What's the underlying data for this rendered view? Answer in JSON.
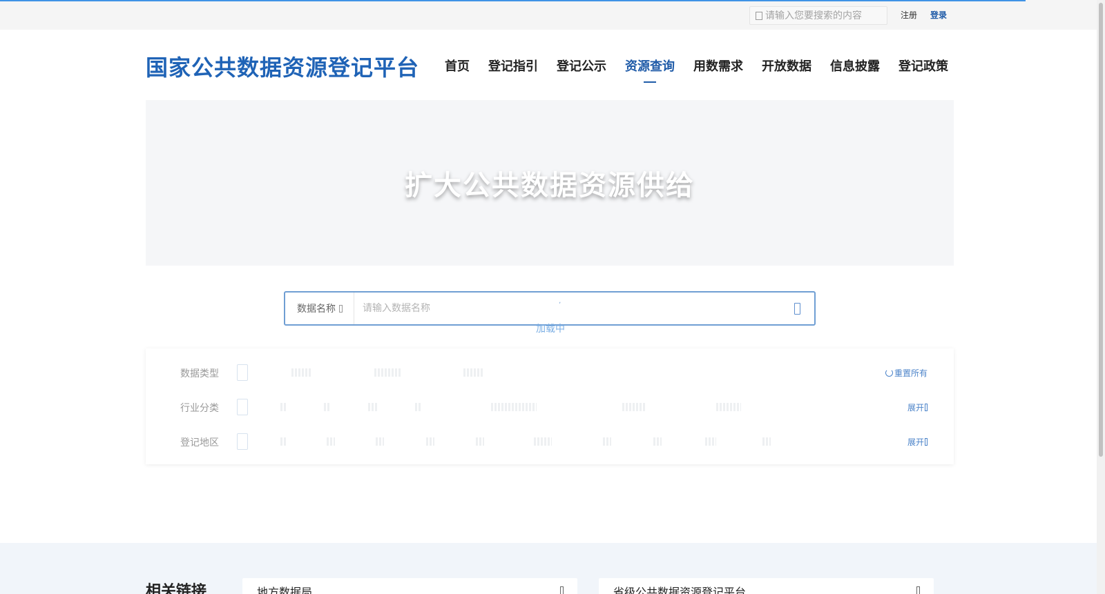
{
  "topbar": {
    "search_placeholder": "请输入您要搜索的内容",
    "register": "注册",
    "login": "登录"
  },
  "header": {
    "logo": "国家公共数据资源登记平台",
    "nav": [
      {
        "label": "首页",
        "active": false
      },
      {
        "label": "登记指引",
        "active": false
      },
      {
        "label": "登记公示",
        "active": false
      },
      {
        "label": "资源查询",
        "active": true
      },
      {
        "label": "用数需求",
        "active": false
      },
      {
        "label": "开放数据",
        "active": false
      },
      {
        "label": "信息披露",
        "active": false
      },
      {
        "label": "登记政策",
        "active": false
      }
    ]
  },
  "banner": {
    "title": "扩大公共数据资源供给"
  },
  "search": {
    "type_label": "数据名称",
    "placeholder": "请输入数据名称",
    "loading_text": "加载中"
  },
  "filters": {
    "data_type_label": "数据类型",
    "industry_label": "行业分类",
    "region_label": "登记地区",
    "reset_label": "重置所有",
    "expand_label": "展开"
  },
  "links": {
    "title": "相关链接",
    "cards": [
      {
        "label": "地方数据局"
      },
      {
        "label": "省级公共数据资源登记平台"
      }
    ]
  },
  "colors": {
    "brand": "#1f63b6",
    "accent": "#1f5ba8",
    "progress": "#3f93e6"
  }
}
